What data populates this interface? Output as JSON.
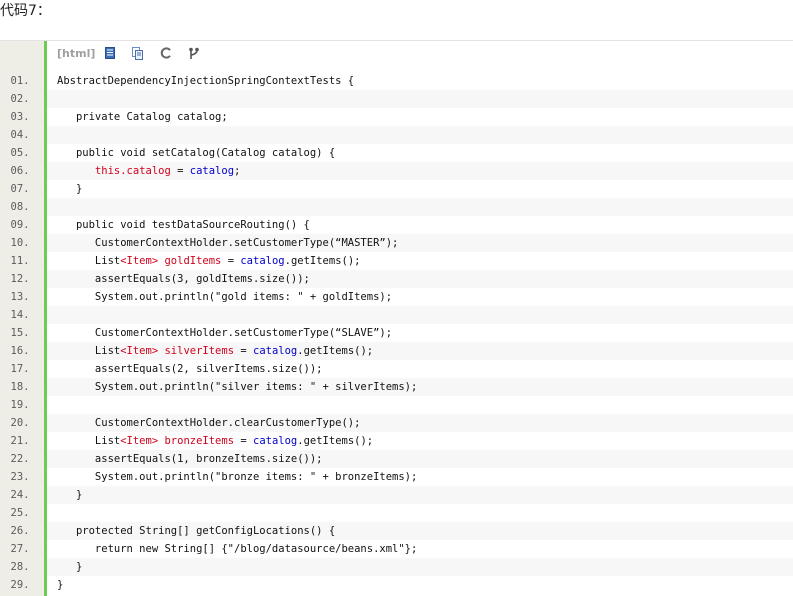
{
  "heading": "代码7：",
  "toolbar": {
    "lang_label": "[html]",
    "icons": [
      "view-source-icon",
      "copy-icon",
      "refresh-icon",
      "fork-icon"
    ]
  },
  "lines": [
    {
      "num": "01.",
      "segments": [
        {
          "t": "AbstractDependencyInjectionSpringContextTests {",
          "c": ""
        }
      ]
    },
    {
      "num": "02.",
      "segments": [
        {
          "t": "",
          "c": ""
        }
      ]
    },
    {
      "num": "03.",
      "segments": [
        {
          "t": "   private Catalog catalog;",
          "c": ""
        }
      ]
    },
    {
      "num": "04.",
      "segments": [
        {
          "t": "",
          "c": ""
        }
      ]
    },
    {
      "num": "05.",
      "segments": [
        {
          "t": "   public void setCatalog(Catalog catalog) {",
          "c": ""
        }
      ]
    },
    {
      "num": "06.",
      "segments": [
        {
          "t": "      ",
          "c": ""
        },
        {
          "t": "this.catalog",
          "c": "red"
        },
        {
          "t": " = ",
          "c": ""
        },
        {
          "t": "catalog",
          "c": "blue"
        },
        {
          "t": ";",
          "c": ""
        }
      ]
    },
    {
      "num": "07.",
      "segments": [
        {
          "t": "   }",
          "c": ""
        }
      ]
    },
    {
      "num": "08.",
      "segments": [
        {
          "t": "",
          "c": ""
        }
      ]
    },
    {
      "num": "09.",
      "segments": [
        {
          "t": "   public void testDataSourceRouting() {",
          "c": ""
        }
      ]
    },
    {
      "num": "10.",
      "segments": [
        {
          "t": "      CustomerContextHolder.setCustomerType(“MASTER”);",
          "c": ""
        }
      ]
    },
    {
      "num": "11.",
      "segments": [
        {
          "t": "      List",
          "c": ""
        },
        {
          "t": "<Item>",
          "c": "red"
        },
        {
          "t": " ",
          "c": ""
        },
        {
          "t": "goldItems",
          "c": "red"
        },
        {
          "t": " = ",
          "c": ""
        },
        {
          "t": "catalog",
          "c": "blue"
        },
        {
          "t": ".getItems();",
          "c": ""
        }
      ]
    },
    {
      "num": "12.",
      "segments": [
        {
          "t": "      assertEquals(3, goldItems.size());",
          "c": ""
        }
      ]
    },
    {
      "num": "13.",
      "segments": [
        {
          "t": "      System.out.println(\"gold items: \" + goldItems);",
          "c": ""
        }
      ]
    },
    {
      "num": "14.",
      "segments": [
        {
          "t": "",
          "c": ""
        }
      ]
    },
    {
      "num": "15.",
      "segments": [
        {
          "t": "      CustomerContextHolder.setCustomerType(“SLAVE”);",
          "c": ""
        }
      ]
    },
    {
      "num": "16.",
      "segments": [
        {
          "t": "      List",
          "c": ""
        },
        {
          "t": "<Item>",
          "c": "red"
        },
        {
          "t": " ",
          "c": ""
        },
        {
          "t": "silverItems",
          "c": "red"
        },
        {
          "t": " = ",
          "c": ""
        },
        {
          "t": "catalog",
          "c": "blue"
        },
        {
          "t": ".getItems();",
          "c": ""
        }
      ]
    },
    {
      "num": "17.",
      "segments": [
        {
          "t": "      assertEquals(2, silverItems.size());",
          "c": ""
        }
      ]
    },
    {
      "num": "18.",
      "segments": [
        {
          "t": "      System.out.println(\"silver items: \" + silverItems);",
          "c": ""
        }
      ]
    },
    {
      "num": "19.",
      "segments": [
        {
          "t": "",
          "c": ""
        }
      ]
    },
    {
      "num": "20.",
      "segments": [
        {
          "t": "      CustomerContextHolder.clearCustomerType();",
          "c": ""
        }
      ]
    },
    {
      "num": "21.",
      "segments": [
        {
          "t": "      List",
          "c": ""
        },
        {
          "t": "<Item>",
          "c": "red"
        },
        {
          "t": " ",
          "c": ""
        },
        {
          "t": "bronzeItems",
          "c": "red"
        },
        {
          "t": " = ",
          "c": ""
        },
        {
          "t": "catalog",
          "c": "blue"
        },
        {
          "t": ".getItems();",
          "c": ""
        }
      ]
    },
    {
      "num": "22.",
      "segments": [
        {
          "t": "      assertEquals(1, bronzeItems.size());",
          "c": ""
        }
      ]
    },
    {
      "num": "23.",
      "segments": [
        {
          "t": "      System.out.println(\"bronze items: \" + bronzeItems);",
          "c": ""
        }
      ]
    },
    {
      "num": "24.",
      "segments": [
        {
          "t": "   }",
          "c": ""
        }
      ]
    },
    {
      "num": "25.",
      "segments": [
        {
          "t": "",
          "c": ""
        }
      ]
    },
    {
      "num": "26.",
      "segments": [
        {
          "t": "   protected String[] getConfigLocations() {",
          "c": ""
        }
      ]
    },
    {
      "num": "27.",
      "segments": [
        {
          "t": "      return new String[] {\"/blog/datasource/beans.xml\"};",
          "c": ""
        }
      ]
    },
    {
      "num": "28.",
      "segments": [
        {
          "t": "   }",
          "c": ""
        }
      ]
    },
    {
      "num": "29.",
      "segments": [
        {
          "t": "}",
          "c": ""
        }
      ]
    }
  ],
  "colors": {
    "gutter": "#eeeee6",
    "accent_bar": "#6ccd54",
    "keyword_red": "#d2001b",
    "identifier_blue": "#0000c8"
  }
}
